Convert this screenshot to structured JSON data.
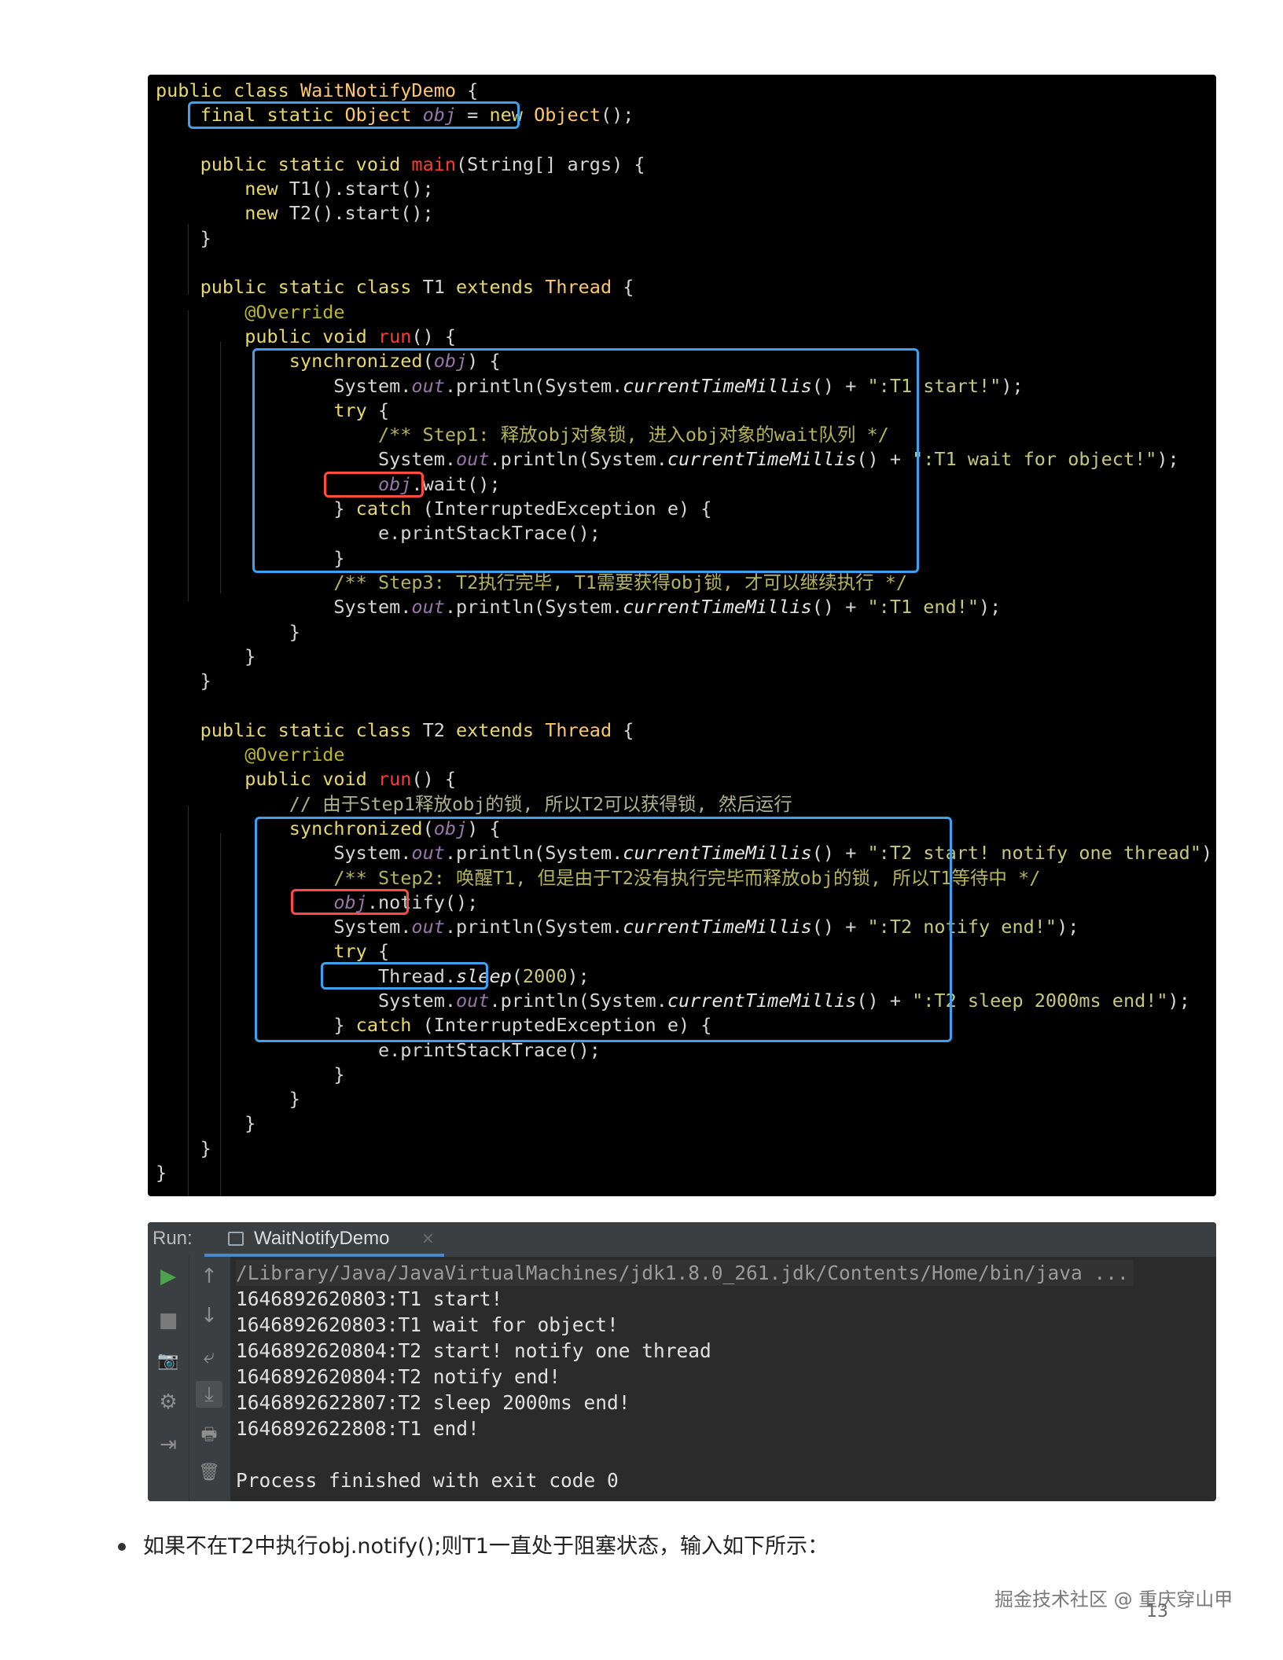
{
  "code": {
    "lines": [
      [
        [
          "k",
          "public class "
        ],
        [
          "t",
          "WaitNotifyDemo"
        ],
        [
          "pl",
          " {"
        ]
      ],
      [
        [
          "pl",
          "    "
        ],
        [
          "k",
          "final static "
        ],
        [
          "t",
          "Object "
        ],
        [
          "f",
          "obj"
        ],
        [
          "pl",
          " = "
        ],
        [
          "k",
          "new "
        ],
        [
          "t",
          "Object"
        ],
        [
          "pl",
          "();"
        ]
      ],
      [
        [
          "pl",
          ""
        ]
      ],
      [
        [
          "pl",
          "    "
        ],
        [
          "k",
          "public static void "
        ],
        [
          "m",
          "main"
        ],
        [
          "pl",
          "(String[] args) {"
        ]
      ],
      [
        [
          "pl",
          "        "
        ],
        [
          "k",
          "new "
        ],
        [
          "pl",
          "T1().start();"
        ]
      ],
      [
        [
          "pl",
          "        "
        ],
        [
          "k",
          "new "
        ],
        [
          "pl",
          "T2().start();"
        ]
      ],
      [
        [
          "pl",
          "    }"
        ]
      ],
      [
        [
          "pl",
          ""
        ]
      ],
      [
        [
          "pl",
          "    "
        ],
        [
          "k",
          "public static class "
        ],
        [
          "pl",
          "T1 "
        ],
        [
          "k",
          "extends "
        ],
        [
          "t",
          "Thread"
        ],
        [
          "pl",
          " {"
        ]
      ],
      [
        [
          "pl",
          "        "
        ],
        [
          "an",
          "@Override"
        ]
      ],
      [
        [
          "pl",
          "        "
        ],
        [
          "k",
          "public void "
        ],
        [
          "m",
          "run"
        ],
        [
          "pl",
          "() {"
        ]
      ],
      [
        [
          "pl",
          "            "
        ],
        [
          "k",
          "synchronized"
        ],
        [
          "pl",
          "("
        ],
        [
          "f",
          "obj"
        ],
        [
          "pl",
          ") {"
        ]
      ],
      [
        [
          "pl",
          "                System."
        ],
        [
          "f",
          "out"
        ],
        [
          "pl",
          ".println(System."
        ],
        [
          "it",
          "currentTimeMillis"
        ],
        [
          "pl",
          "() + "
        ],
        [
          "s",
          "\":T1 start!\""
        ],
        [
          "pl",
          ");"
        ]
      ],
      [
        [
          "pl",
          "                "
        ],
        [
          "k",
          "try"
        ],
        [
          "pl",
          " {"
        ]
      ],
      [
        [
          "pl",
          "                    "
        ],
        [
          "c",
          "/** Step1: 释放obj对象锁, 进入obj对象的wait队列 */"
        ]
      ],
      [
        [
          "pl",
          "                    System."
        ],
        [
          "f",
          "out"
        ],
        [
          "pl",
          ".println(System."
        ],
        [
          "it",
          "currentTimeMillis"
        ],
        [
          "pl",
          "() + "
        ],
        [
          "s",
          "\":T1 wait for object!\""
        ],
        [
          "pl",
          ");"
        ]
      ],
      [
        [
          "pl",
          "                    "
        ],
        [
          "f",
          "obj"
        ],
        [
          "pl",
          ".wait();"
        ]
      ],
      [
        [
          "pl",
          "                } "
        ],
        [
          "k",
          "catch"
        ],
        [
          "pl",
          " (InterruptedException e) {"
        ]
      ],
      [
        [
          "pl",
          "                    e.printStackTrace();"
        ]
      ],
      [
        [
          "pl",
          "                }"
        ]
      ],
      [
        [
          "pl",
          "                "
        ],
        [
          "c",
          "/** Step3: T2执行完毕, T1需要获得obj锁, 才可以继续执行 */"
        ]
      ],
      [
        [
          "pl",
          "                System."
        ],
        [
          "f",
          "out"
        ],
        [
          "pl",
          ".println(System."
        ],
        [
          "it",
          "currentTimeMillis"
        ],
        [
          "pl",
          "() + "
        ],
        [
          "s",
          "\":T1 end!\""
        ],
        [
          "pl",
          ");"
        ]
      ],
      [
        [
          "pl",
          "            }"
        ]
      ],
      [
        [
          "pl",
          "        }"
        ]
      ],
      [
        [
          "pl",
          "    }"
        ]
      ],
      [
        [
          "pl",
          ""
        ]
      ],
      [
        [
          "pl",
          "    "
        ],
        [
          "k",
          "public static class "
        ],
        [
          "pl",
          "T2 "
        ],
        [
          "k",
          "extends "
        ],
        [
          "t",
          "Thread"
        ],
        [
          "pl",
          " {"
        ]
      ],
      [
        [
          "pl",
          "        "
        ],
        [
          "an",
          "@Override"
        ]
      ],
      [
        [
          "pl",
          "        "
        ],
        [
          "k",
          "public void "
        ],
        [
          "m",
          "run"
        ],
        [
          "pl",
          "() {"
        ]
      ],
      [
        [
          "pl",
          "            "
        ],
        [
          "cm",
          "// 由于Step1释放obj的锁, 所以T2可以获得锁, 然后运行"
        ]
      ],
      [
        [
          "pl",
          "            "
        ],
        [
          "k",
          "synchronized"
        ],
        [
          "pl",
          "("
        ],
        [
          "f",
          "obj"
        ],
        [
          "pl",
          ") {"
        ]
      ],
      [
        [
          "pl",
          "                System."
        ],
        [
          "f",
          "out"
        ],
        [
          "pl",
          ".println(System."
        ],
        [
          "it",
          "currentTimeMillis"
        ],
        [
          "pl",
          "() + "
        ],
        [
          "s",
          "\":T2 start! notify one thread\""
        ],
        [
          "pl",
          ");"
        ]
      ],
      [
        [
          "pl",
          "                "
        ],
        [
          "c",
          "/** Step2: 唤醒T1, 但是由于T2没有执行完毕而释放obj的锁, 所以T1等待中 */"
        ]
      ],
      [
        [
          "pl",
          "                "
        ],
        [
          "f",
          "obj"
        ],
        [
          "pl",
          ".notify();"
        ]
      ],
      [
        [
          "pl",
          "                System."
        ],
        [
          "f",
          "out"
        ],
        [
          "pl",
          ".println(System."
        ],
        [
          "it",
          "currentTimeMillis"
        ],
        [
          "pl",
          "() + "
        ],
        [
          "s",
          "\":T2 notify end!\""
        ],
        [
          "pl",
          ");"
        ]
      ],
      [
        [
          "pl",
          "                "
        ],
        [
          "k",
          "try"
        ],
        [
          "pl",
          " {"
        ]
      ],
      [
        [
          "pl",
          "                    Thread."
        ],
        [
          "it",
          "sleep"
        ],
        [
          "pl",
          "("
        ],
        [
          "s",
          "2000"
        ],
        [
          "pl",
          ");"
        ]
      ],
      [
        [
          "pl",
          "                    System."
        ],
        [
          "f",
          "out"
        ],
        [
          "pl",
          ".println(System."
        ],
        [
          "it",
          "currentTimeMillis"
        ],
        [
          "pl",
          "() + "
        ],
        [
          "s",
          "\":T2 sleep 2000ms end!\""
        ],
        [
          "pl",
          ");"
        ]
      ],
      [
        [
          "pl",
          "                } "
        ],
        [
          "k",
          "catch"
        ],
        [
          "pl",
          " (InterruptedException e) {"
        ]
      ],
      [
        [
          "pl",
          "                    e.printStackTrace();"
        ]
      ],
      [
        [
          "pl",
          "                }"
        ]
      ],
      [
        [
          "pl",
          "            }"
        ]
      ],
      [
        [
          "pl",
          "        }"
        ]
      ],
      [
        [
          "pl",
          "    }"
        ]
      ],
      [
        [
          "pl",
          "}"
        ]
      ]
    ]
  },
  "run": {
    "label": "Run:",
    "tab_title": "WaitNotifyDemo",
    "tab_close": "×",
    "command": "/Library/Java/JavaVirtualMachines/jdk1.8.0_261.jdk/Contents/Home/bin/java ...",
    "output": [
      "1646892620803:T1 start!",
      "1646892620803:T1 wait for object!",
      "1646892620804:T2 start! notify one thread",
      "1646892620804:T2 notify end!",
      "1646892622807:T2 sleep 2000ms end!",
      "1646892622808:T1 end!",
      "",
      "Process finished with exit code 0"
    ],
    "tools_left": [
      "▶",
      "■",
      "📷",
      "⚙",
      "⇥"
    ],
    "tools_right": [
      "↑",
      "↓",
      "⤶",
      "⤓",
      "🖶",
      "🗑"
    ]
  },
  "bullet_text": "如果不在T2中执行obj.notify();则T1一直处于阻塞状态，输入如下所示：",
  "watermark": "掘金技术社区 @ 重庆穿山甲",
  "page_number": "13"
}
